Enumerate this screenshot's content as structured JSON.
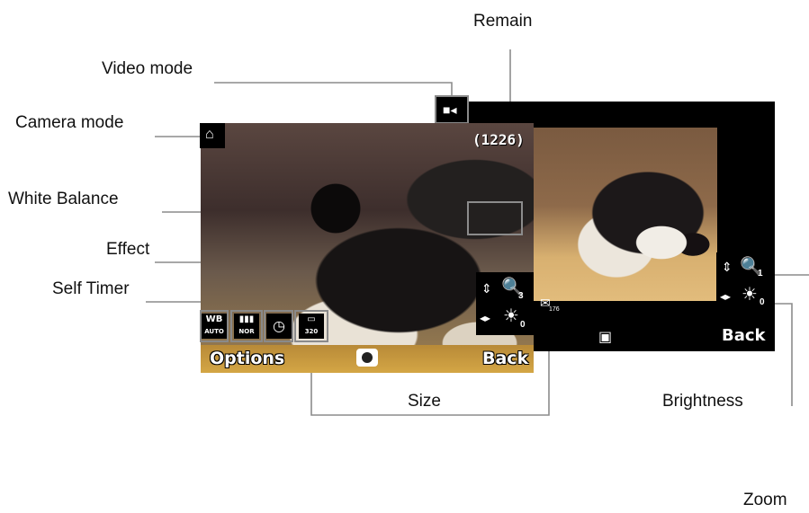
{
  "labels": {
    "remain": "Remain",
    "video_mode": "Video mode",
    "camera_mode": "Camera mode",
    "white_balance": "White Balance",
    "effect": "Effect",
    "self_timer": "Self Timer",
    "size": "Size",
    "brightness": "Brightness",
    "zoom": "Zoom"
  },
  "screen": {
    "remain_count": "(1226)",
    "softkey_left": "Options",
    "softkey_right": "Back",
    "back_softkey_right": "Back",
    "wb_icon_text": "WB",
    "wb_icon_sub": "AUTO",
    "effect_icon_sub": "NOR",
    "size_icon_sub": "320",
    "zoom_value": "3",
    "brightness_value": "0",
    "back_zoom_value": "1",
    "back_brightness_value": "0",
    "back_size_sub": "176"
  },
  "colors": {
    "softkey_bar": "#d4a645",
    "callout_line": "#8c8c8c"
  }
}
